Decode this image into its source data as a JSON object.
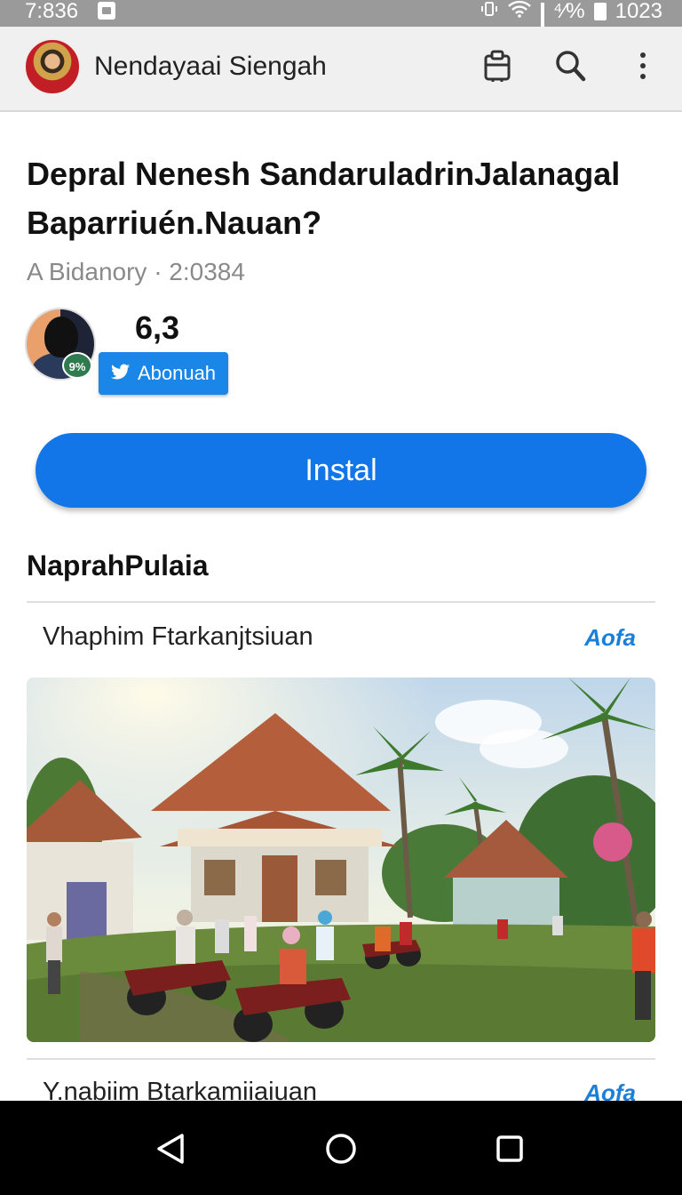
{
  "status_bar": {
    "time": "7:836",
    "battery_pct": "⁴⁄%",
    "clock_right": "1023"
  },
  "app_bar": {
    "title": "Nendayaai Siengah",
    "icons": [
      "clipboard-icon",
      "search-icon",
      "more-vertical-icon"
    ]
  },
  "article": {
    "headline": "Depral Nenesh SandaruladrinJalanagal Baparriuén.Nauan?",
    "byline": "A Bidanory · 2:0384",
    "author_badge": "9%",
    "rating": "6,3",
    "follow_label": "Abonuah",
    "install_label": "Instal"
  },
  "section": {
    "title": "NaprahPulaia",
    "items": [
      {
        "title": "Vhaphim Ftarkanjtsiuan",
        "tag": "Aofa"
      },
      {
        "title": "Y.nabiim Btarkamiiaiuan",
        "tag": "Aofa"
      }
    ]
  },
  "colors": {
    "accent": "#1275e8",
    "follow": "#1a86e8",
    "tag": "#1a7fd8"
  }
}
